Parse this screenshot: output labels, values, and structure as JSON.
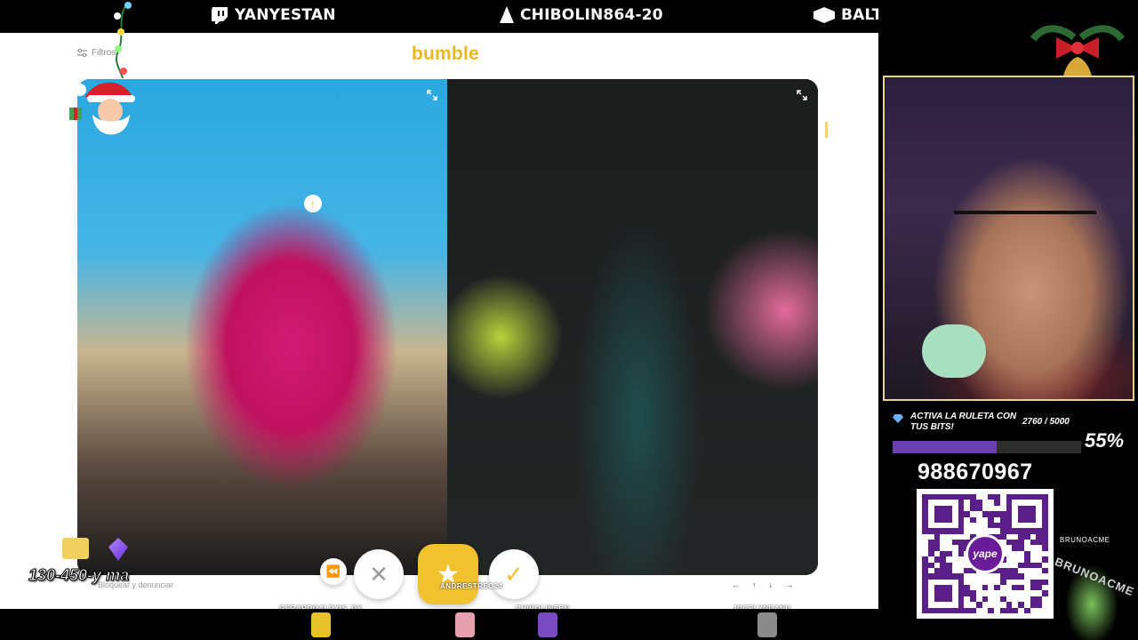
{
  "top_bar": {
    "items": [
      {
        "icon": "twitch-icon",
        "label": "YANYESTAN"
      },
      {
        "icon": "kick-icon",
        "label": "CHIBOLIN864-20"
      },
      {
        "icon": "bar-icon",
        "label": "BALTAZAR_BAR"
      }
    ]
  },
  "app": {
    "logo": "bumble",
    "filters_label": "Filtros",
    "blocked_label": "Bloquear y denunciar",
    "actions": {
      "back": "⏪",
      "pass": "✕",
      "superswipe": "★",
      "like": "✓"
    },
    "nav": [
      "←",
      "↑",
      "↓",
      "→"
    ]
  },
  "overlay": {
    "donation_text": "130-450-y ma",
    "names": [
      "GERARDOALEXIS_OK",
      "ANDRESTREC24",
      "CHIBOLINSEN",
      "JOCELYNDANU"
    ]
  },
  "goal": {
    "label": "ACTIVA LA RULETA CON TUS BITS!",
    "count": "2760 / 5000",
    "percent_label": "55%",
    "progress": 0.55
  },
  "payment": {
    "phone": "988670967",
    "app_name": "yape"
  },
  "follower": {
    "name": "BRUNOACME",
    "sticker_name": "BRUNOACME"
  },
  "colors": {
    "bumble_yellow": "#e8b923",
    "goal_fill": "#6a3fb0",
    "yape_purple": "#6a1b9a"
  }
}
